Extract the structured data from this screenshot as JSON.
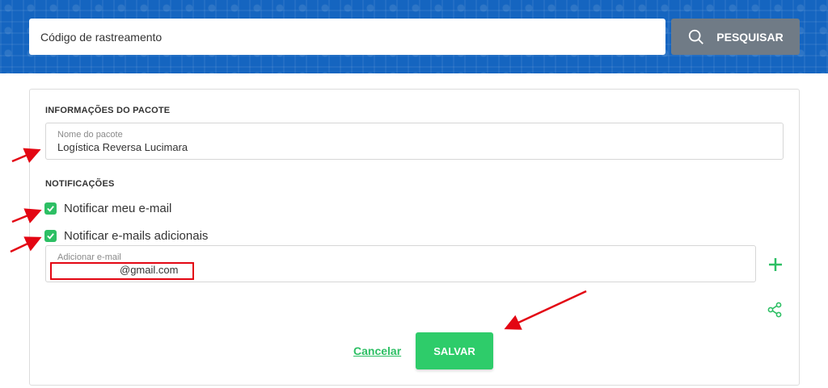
{
  "header": {
    "search_placeholder": "Código de rastreamento",
    "search_button_label": "PESQUISAR"
  },
  "package_info": {
    "section_title": "INFORMAÇÕES DO PACOTE",
    "name_label": "Nome do pacote",
    "name_value": "Logística Reversa Lucimara"
  },
  "notifications": {
    "section_title": "NOTIFICAÇÕES",
    "notify_my_email_label": "Notificar meu e-mail",
    "notify_my_email_checked": true,
    "notify_additional_label": "Notificar e-mails adicionais",
    "notify_additional_checked": true,
    "additional_email_label": "Adicionar e-mail",
    "additional_email_value": "@gmail.com"
  },
  "actions": {
    "cancel_label": "Cancelar",
    "save_label": "SALVAR"
  },
  "colors": {
    "banner": "#1565c0",
    "search_button": "#707b86",
    "accent_green": "#2dbf64",
    "annotation_red": "#e30613"
  }
}
